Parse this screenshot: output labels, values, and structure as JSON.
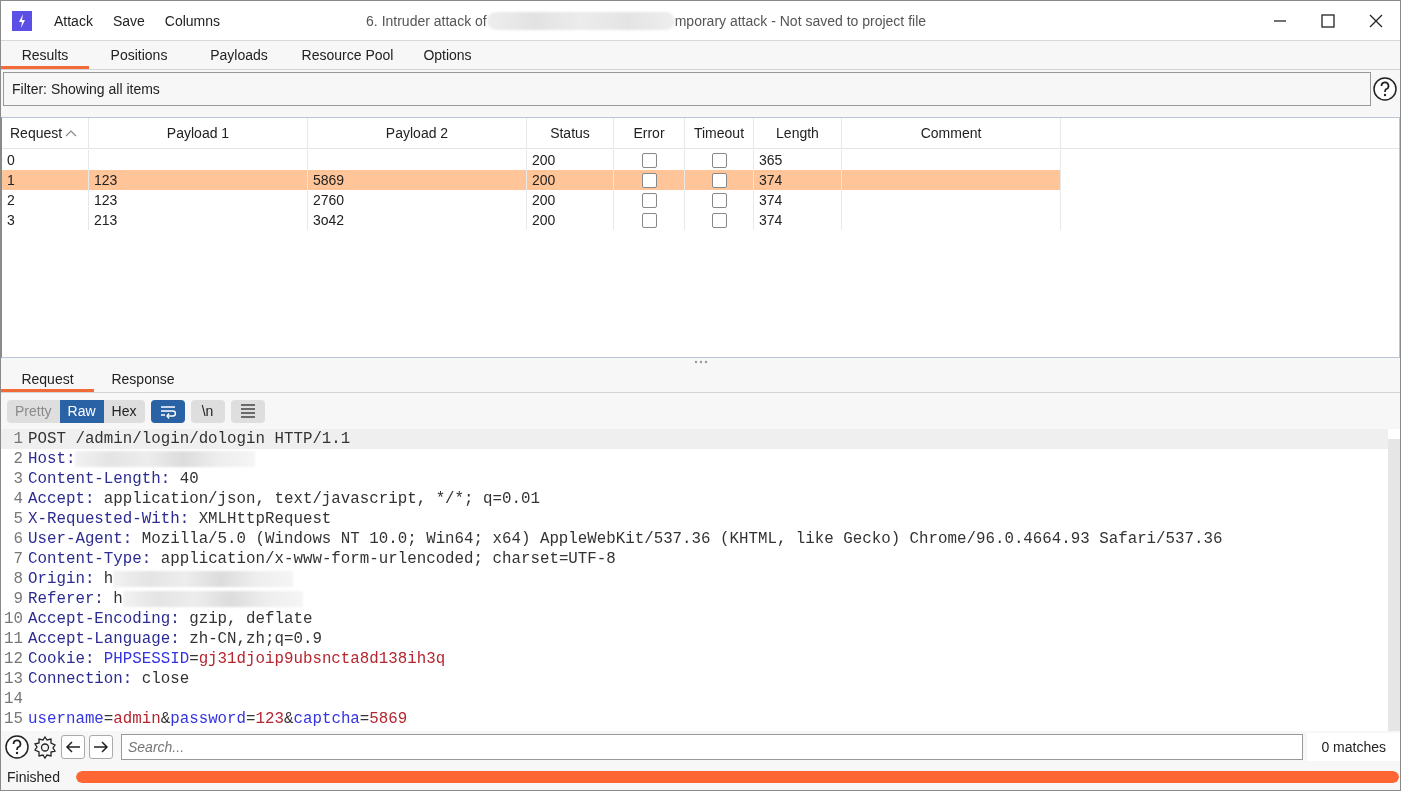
{
  "window": {
    "title_start": "6. Intruder attack of ",
    "title_end": "mporary attack - Not saved to project file"
  },
  "menu": [
    "Attack",
    "Save",
    "Columns"
  ],
  "tabs": [
    {
      "label": "Results",
      "selected": true
    },
    {
      "label": "Positions",
      "selected": false
    },
    {
      "label": "Payloads",
      "selected": false
    },
    {
      "label": "Resource Pool",
      "selected": false
    },
    {
      "label": "Options",
      "selected": false
    }
  ],
  "filter": "Filter: Showing all items",
  "table": {
    "columns": [
      {
        "label": "Request",
        "sorted": true
      },
      {
        "label": "Payload 1",
        "sorted": false
      },
      {
        "label": "Payload 2",
        "sorted": false
      },
      {
        "label": "Status",
        "sorted": false
      },
      {
        "label": "Error",
        "sorted": false
      },
      {
        "label": "Timeout",
        "sorted": false
      },
      {
        "label": "Length",
        "sorted": false
      },
      {
        "label": "Comment",
        "sorted": false
      }
    ],
    "rows": [
      {
        "request": "0",
        "status": "200",
        "error": false,
        "timeout": false,
        "length": "365",
        "selected": false
      },
      {
        "request": "1",
        "payload_1": "123",
        "payload_2": "5869",
        "status": "200",
        "error": false,
        "timeout": false,
        "length": "374",
        "selected": true
      },
      {
        "request": "2",
        "payload_1": "123",
        "payload_2": "2760",
        "status": "200",
        "error": false,
        "timeout": false,
        "length": "374",
        "selected": false
      },
      {
        "request": "3",
        "payload_1": "213",
        "payload_2": "3o42",
        "status": "200",
        "error": false,
        "timeout": false,
        "length": "374",
        "selected": false
      }
    ]
  },
  "message_tabs": [
    {
      "label": "Request",
      "selected": true
    },
    {
      "label": "Response",
      "selected": false
    }
  ],
  "view_modes": [
    {
      "label": "Pretty",
      "selected": false
    },
    {
      "label": "Raw",
      "selected": true
    },
    {
      "label": "Hex",
      "selected": false
    }
  ],
  "wrap_lines": {
    "on": true
  },
  "newline_toggle": {
    "label": "\\n",
    "on": false
  },
  "lines": [
    {
      "number": "1",
      "highlighted": true,
      "segments": [
        {
          "kind": "plain",
          "text": "POST /admin/login/dologin HTTP/1.1"
        }
      ]
    },
    {
      "number": "2",
      "highlighted": false,
      "segments": [
        {
          "kind": "header",
          "text": "Host:"
        },
        {
          "kind": "redacted"
        }
      ]
    },
    {
      "number": "3",
      "highlighted": false,
      "segments": [
        {
          "kind": "header",
          "text": "Content-Length:"
        },
        {
          "kind": "plain",
          "text": " 40"
        }
      ]
    },
    {
      "number": "4",
      "highlighted": false,
      "segments": [
        {
          "kind": "header",
          "text": "Accept:"
        },
        {
          "kind": "plain",
          "text": " application/json, text/javascript, */*; q=0.01"
        }
      ]
    },
    {
      "number": "5",
      "highlighted": false,
      "segments": [
        {
          "kind": "header",
          "text": "X-Requested-With:"
        },
        {
          "kind": "plain",
          "text": " XMLHttpRequest"
        }
      ]
    },
    {
      "number": "6",
      "highlighted": false,
      "segments": [
        {
          "kind": "header",
          "text": "User-Agent:"
        },
        {
          "kind": "plain",
          "text": " Mozilla/5.0 (Windows NT 10.0; Win64; x64) AppleWebKit/537.36 (KHTML, like Gecko) Chrome/96.0.4664.93 Safari/537.36"
        }
      ]
    },
    {
      "number": "7",
      "highlighted": false,
      "segments": [
        {
          "kind": "header",
          "text": "Content-Type:"
        },
        {
          "kind": "plain",
          "text": " application/x-www-form-urlencoded; charset=UTF-8"
        }
      ]
    },
    {
      "number": "8",
      "highlighted": false,
      "segments": [
        {
          "kind": "header",
          "text": "Origin:"
        },
        {
          "kind": "plain",
          "text": " h"
        },
        {
          "kind": "redacted"
        }
      ]
    },
    {
      "number": "9",
      "highlighted": false,
      "segments": [
        {
          "kind": "header",
          "text": "Referer:"
        },
        {
          "kind": "plain",
          "text": " h"
        },
        {
          "kind": "redacted"
        }
      ]
    },
    {
      "number": "10",
      "highlighted": false,
      "segments": [
        {
          "kind": "header",
          "text": "Accept-Encoding:"
        },
        {
          "kind": "plain",
          "text": " gzip, deflate"
        }
      ]
    },
    {
      "number": "11",
      "highlighted": false,
      "segments": [
        {
          "kind": "header",
          "text": "Accept-Language:"
        },
        {
          "kind": "plain",
          "text": " zh-CN,zh;q=0.9"
        }
      ]
    },
    {
      "number": "12",
      "highlighted": false,
      "segments": [
        {
          "kind": "header",
          "text": "Cookie:"
        },
        {
          "kind": "param",
          "text": " PHPSESSID"
        },
        {
          "kind": "plain",
          "text": "="
        },
        {
          "kind": "value",
          "text": "gj31djoip9ubsncta8d138ih3q"
        }
      ]
    },
    {
      "number": "13",
      "highlighted": false,
      "segments": [
        {
          "kind": "header",
          "text": "Connection:"
        },
        {
          "kind": "plain",
          "text": " close"
        }
      ]
    },
    {
      "number": "14",
      "highlighted": false
    },
    {
      "number": "15",
      "highlighted": false,
      "segments": [
        {
          "kind": "param",
          "text": "username"
        },
        {
          "kind": "plain",
          "text": "="
        },
        {
          "kind": "value",
          "text": "admin"
        },
        {
          "kind": "plain",
          "text": "&"
        },
        {
          "kind": "param",
          "text": "password"
        },
        {
          "kind": "plain",
          "text": "="
        },
        {
          "kind": "value",
          "text": "123"
        },
        {
          "kind": "plain",
          "text": "&"
        },
        {
          "kind": "param",
          "text": "captcha"
        },
        {
          "kind": "plain",
          "text": "="
        },
        {
          "kind": "value",
          "text": "5869"
        }
      ]
    }
  ],
  "search": {
    "placeholder": "Search...",
    "matches": "0 matches"
  },
  "status": {
    "label": "Finished",
    "level": 1
  }
}
